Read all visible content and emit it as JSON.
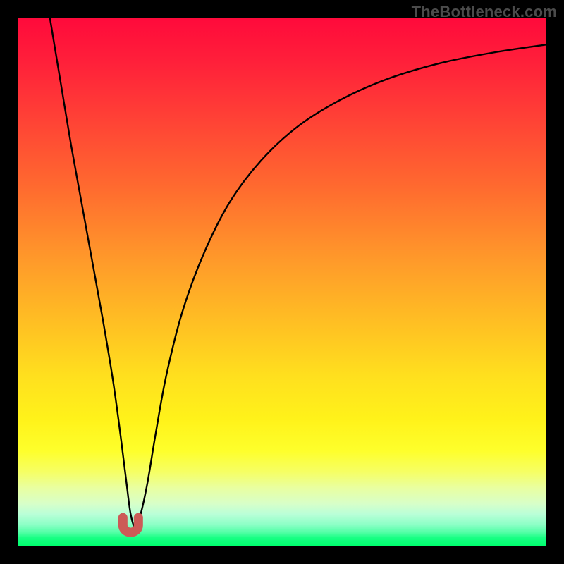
{
  "watermark": "TheBottleneck.com",
  "colors": {
    "frame": "#000000",
    "curve_stroke": "#000000",
    "marker_fill": "#cc5a57",
    "gradient_top": "#ff0a3b",
    "gradient_bottom": "#00ff6e"
  },
  "chart_data": {
    "type": "line",
    "title": "",
    "xlabel": "",
    "ylabel": "",
    "xlim": [
      0,
      100
    ],
    "ylim": [
      0,
      100
    ],
    "grid": false,
    "legend": false,
    "notes": "No numeric axis ticks or labels are rendered on the image; x and y are normalized to 0–100 across the plot box. Curve points are visual estimates of the black trace. The U marker sits at the curve minimum.",
    "series": [
      {
        "name": "curve",
        "x": [
          6,
          8,
          10,
          12,
          14,
          16,
          18,
          19.5,
          20.5,
          21.3,
          22.2,
          23.2,
          24.5,
          26,
          28,
          31,
          35,
          40,
          46,
          53,
          61,
          70,
          80,
          90,
          100
        ],
        "y": [
          100,
          88,
          76,
          65,
          54,
          43,
          31,
          20,
          12,
          6,
          3.5,
          6,
          12,
          21,
          32,
          44,
          55,
          65,
          73,
          79.5,
          84.5,
          88.5,
          91.5,
          93.5,
          95
        ]
      }
    ],
    "u_marker": {
      "x": 21.3,
      "y": 3.2,
      "label": "U"
    }
  }
}
